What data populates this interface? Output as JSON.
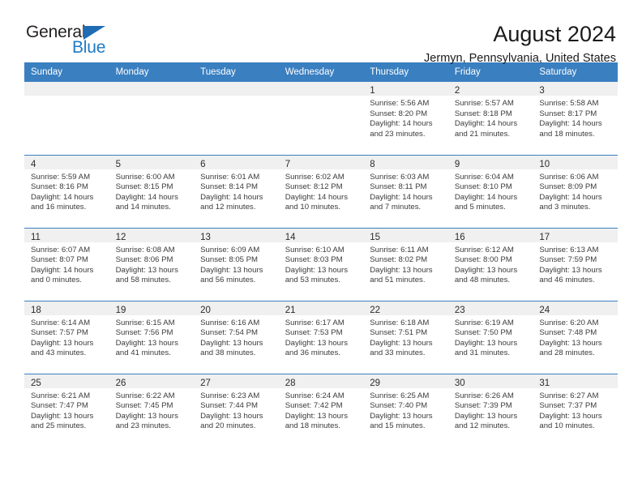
{
  "brand": {
    "name_part1": "General",
    "name_part2": "Blue",
    "accent_color": "#1f7ac4",
    "triangle_color": "#1f6cb4"
  },
  "header": {
    "title": "August 2024",
    "subtitle": "Jermyn, Pennsylvania, United States"
  },
  "calendar": {
    "header_bg": "#3a7fc0",
    "daynum_bg": "#f0f0f0",
    "weekday_headers": [
      "Sunday",
      "Monday",
      "Tuesday",
      "Wednesday",
      "Thursday",
      "Friday",
      "Saturday"
    ],
    "weeks": [
      [
        {
          "day": "",
          "sunrise": "",
          "sunset": "",
          "daylight_line1": "",
          "daylight_line2": ""
        },
        {
          "day": "",
          "sunrise": "",
          "sunset": "",
          "daylight_line1": "",
          "daylight_line2": ""
        },
        {
          "day": "",
          "sunrise": "",
          "sunset": "",
          "daylight_line1": "",
          "daylight_line2": ""
        },
        {
          "day": "",
          "sunrise": "",
          "sunset": "",
          "daylight_line1": "",
          "daylight_line2": ""
        },
        {
          "day": "1",
          "sunrise": "Sunrise: 5:56 AM",
          "sunset": "Sunset: 8:20 PM",
          "daylight_line1": "Daylight: 14 hours",
          "daylight_line2": "and 23 minutes."
        },
        {
          "day": "2",
          "sunrise": "Sunrise: 5:57 AM",
          "sunset": "Sunset: 8:18 PM",
          "daylight_line1": "Daylight: 14 hours",
          "daylight_line2": "and 21 minutes."
        },
        {
          "day": "3",
          "sunrise": "Sunrise: 5:58 AM",
          "sunset": "Sunset: 8:17 PM",
          "daylight_line1": "Daylight: 14 hours",
          "daylight_line2": "and 18 minutes."
        }
      ],
      [
        {
          "day": "4",
          "sunrise": "Sunrise: 5:59 AM",
          "sunset": "Sunset: 8:16 PM",
          "daylight_line1": "Daylight: 14 hours",
          "daylight_line2": "and 16 minutes."
        },
        {
          "day": "5",
          "sunrise": "Sunrise: 6:00 AM",
          "sunset": "Sunset: 8:15 PM",
          "daylight_line1": "Daylight: 14 hours",
          "daylight_line2": "and 14 minutes."
        },
        {
          "day": "6",
          "sunrise": "Sunrise: 6:01 AM",
          "sunset": "Sunset: 8:14 PM",
          "daylight_line1": "Daylight: 14 hours",
          "daylight_line2": "and 12 minutes."
        },
        {
          "day": "7",
          "sunrise": "Sunrise: 6:02 AM",
          "sunset": "Sunset: 8:12 PM",
          "daylight_line1": "Daylight: 14 hours",
          "daylight_line2": "and 10 minutes."
        },
        {
          "day": "8",
          "sunrise": "Sunrise: 6:03 AM",
          "sunset": "Sunset: 8:11 PM",
          "daylight_line1": "Daylight: 14 hours",
          "daylight_line2": "and 7 minutes."
        },
        {
          "day": "9",
          "sunrise": "Sunrise: 6:04 AM",
          "sunset": "Sunset: 8:10 PM",
          "daylight_line1": "Daylight: 14 hours",
          "daylight_line2": "and 5 minutes."
        },
        {
          "day": "10",
          "sunrise": "Sunrise: 6:06 AM",
          "sunset": "Sunset: 8:09 PM",
          "daylight_line1": "Daylight: 14 hours",
          "daylight_line2": "and 3 minutes."
        }
      ],
      [
        {
          "day": "11",
          "sunrise": "Sunrise: 6:07 AM",
          "sunset": "Sunset: 8:07 PM",
          "daylight_line1": "Daylight: 14 hours",
          "daylight_line2": "and 0 minutes."
        },
        {
          "day": "12",
          "sunrise": "Sunrise: 6:08 AM",
          "sunset": "Sunset: 8:06 PM",
          "daylight_line1": "Daylight: 13 hours",
          "daylight_line2": "and 58 minutes."
        },
        {
          "day": "13",
          "sunrise": "Sunrise: 6:09 AM",
          "sunset": "Sunset: 8:05 PM",
          "daylight_line1": "Daylight: 13 hours",
          "daylight_line2": "and 56 minutes."
        },
        {
          "day": "14",
          "sunrise": "Sunrise: 6:10 AM",
          "sunset": "Sunset: 8:03 PM",
          "daylight_line1": "Daylight: 13 hours",
          "daylight_line2": "and 53 minutes."
        },
        {
          "day": "15",
          "sunrise": "Sunrise: 6:11 AM",
          "sunset": "Sunset: 8:02 PM",
          "daylight_line1": "Daylight: 13 hours",
          "daylight_line2": "and 51 minutes."
        },
        {
          "day": "16",
          "sunrise": "Sunrise: 6:12 AM",
          "sunset": "Sunset: 8:00 PM",
          "daylight_line1": "Daylight: 13 hours",
          "daylight_line2": "and 48 minutes."
        },
        {
          "day": "17",
          "sunrise": "Sunrise: 6:13 AM",
          "sunset": "Sunset: 7:59 PM",
          "daylight_line1": "Daylight: 13 hours",
          "daylight_line2": "and 46 minutes."
        }
      ],
      [
        {
          "day": "18",
          "sunrise": "Sunrise: 6:14 AM",
          "sunset": "Sunset: 7:57 PM",
          "daylight_line1": "Daylight: 13 hours",
          "daylight_line2": "and 43 minutes."
        },
        {
          "day": "19",
          "sunrise": "Sunrise: 6:15 AM",
          "sunset": "Sunset: 7:56 PM",
          "daylight_line1": "Daylight: 13 hours",
          "daylight_line2": "and 41 minutes."
        },
        {
          "day": "20",
          "sunrise": "Sunrise: 6:16 AM",
          "sunset": "Sunset: 7:54 PM",
          "daylight_line1": "Daylight: 13 hours",
          "daylight_line2": "and 38 minutes."
        },
        {
          "day": "21",
          "sunrise": "Sunrise: 6:17 AM",
          "sunset": "Sunset: 7:53 PM",
          "daylight_line1": "Daylight: 13 hours",
          "daylight_line2": "and 36 minutes."
        },
        {
          "day": "22",
          "sunrise": "Sunrise: 6:18 AM",
          "sunset": "Sunset: 7:51 PM",
          "daylight_line1": "Daylight: 13 hours",
          "daylight_line2": "and 33 minutes."
        },
        {
          "day": "23",
          "sunrise": "Sunrise: 6:19 AM",
          "sunset": "Sunset: 7:50 PM",
          "daylight_line1": "Daylight: 13 hours",
          "daylight_line2": "and 31 minutes."
        },
        {
          "day": "24",
          "sunrise": "Sunrise: 6:20 AM",
          "sunset": "Sunset: 7:48 PM",
          "daylight_line1": "Daylight: 13 hours",
          "daylight_line2": "and 28 minutes."
        }
      ],
      [
        {
          "day": "25",
          "sunrise": "Sunrise: 6:21 AM",
          "sunset": "Sunset: 7:47 PM",
          "daylight_line1": "Daylight: 13 hours",
          "daylight_line2": "and 25 minutes."
        },
        {
          "day": "26",
          "sunrise": "Sunrise: 6:22 AM",
          "sunset": "Sunset: 7:45 PM",
          "daylight_line1": "Daylight: 13 hours",
          "daylight_line2": "and 23 minutes."
        },
        {
          "day": "27",
          "sunrise": "Sunrise: 6:23 AM",
          "sunset": "Sunset: 7:44 PM",
          "daylight_line1": "Daylight: 13 hours",
          "daylight_line2": "and 20 minutes."
        },
        {
          "day": "28",
          "sunrise": "Sunrise: 6:24 AM",
          "sunset": "Sunset: 7:42 PM",
          "daylight_line1": "Daylight: 13 hours",
          "daylight_line2": "and 18 minutes."
        },
        {
          "day": "29",
          "sunrise": "Sunrise: 6:25 AM",
          "sunset": "Sunset: 7:40 PM",
          "daylight_line1": "Daylight: 13 hours",
          "daylight_line2": "and 15 minutes."
        },
        {
          "day": "30",
          "sunrise": "Sunrise: 6:26 AM",
          "sunset": "Sunset: 7:39 PM",
          "daylight_line1": "Daylight: 13 hours",
          "daylight_line2": "and 12 minutes."
        },
        {
          "day": "31",
          "sunrise": "Sunrise: 6:27 AM",
          "sunset": "Sunset: 7:37 PM",
          "daylight_line1": "Daylight: 13 hours",
          "daylight_line2": "and 10 minutes."
        }
      ]
    ]
  }
}
